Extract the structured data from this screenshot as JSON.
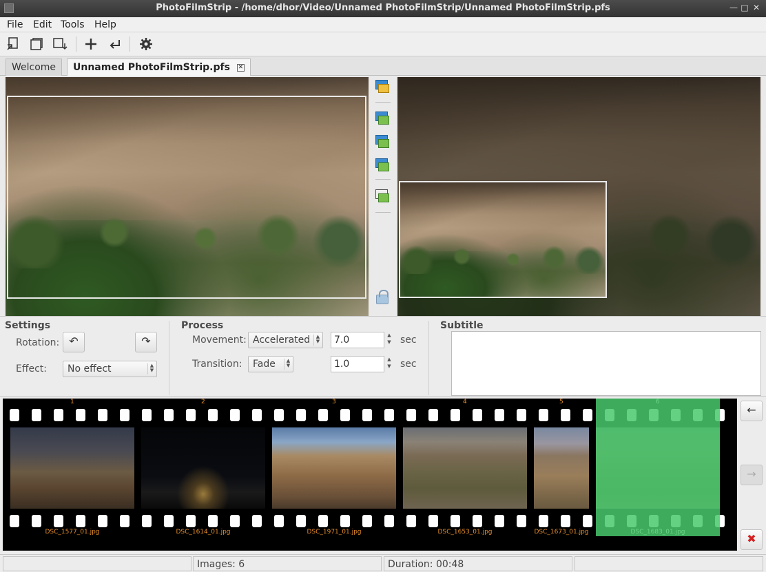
{
  "window": {
    "title": "PhotoFilmStrip - /home/dhor/Video/Unnamed PhotoFilmStrip/Unnamed PhotoFilmStrip.pfs",
    "controls": {
      "minimize": "—",
      "maximize": "□",
      "close": "✕"
    }
  },
  "menubar": {
    "items": [
      "File",
      "Edit",
      "Tools",
      "Help"
    ]
  },
  "toolbar": {
    "icons": [
      "new-project-icon",
      "open-project-icon",
      "save-project-icon",
      "add-images-icon",
      "undo-icon",
      "settings-icon"
    ]
  },
  "tabs": [
    {
      "label": "Welcome",
      "active": false
    },
    {
      "label": "Unnamed PhotoFilmStrip.pfs",
      "active": true,
      "close": "✕"
    }
  ],
  "settings": {
    "title": "Settings",
    "rotation_label": "Rotation:",
    "rotate_left": "↶",
    "rotate_right": "↷",
    "effect_label": "Effect:",
    "effect_value": "No effect"
  },
  "process": {
    "title": "Process",
    "movement_label": "Movement:",
    "movement_value": "Accelerated",
    "movement_duration": "7.0",
    "movement_unit": "sec",
    "transition_label": "Transition:",
    "transition_value": "Fade",
    "transition_duration": "1.0",
    "transition_unit": "sec"
  },
  "subtitle": {
    "title": "Subtitle",
    "value": ""
  },
  "filmstrip": {
    "items": [
      {
        "number": "1",
        "filename": "DSC_1577_01.jpg"
      },
      {
        "number": "2",
        "filename": "DSC_1614_01.jpg"
      },
      {
        "number": "3",
        "filename": "DSC_1971_01.jpg"
      },
      {
        "number": "4",
        "filename": "DSC_1653_01.jpg"
      },
      {
        "number": "5",
        "filename": "DSC_1673_01.jpg"
      },
      {
        "number": "6",
        "filename": "DSC_1683_01.jpg"
      }
    ],
    "selected_index": 5,
    "left_arrow": "←",
    "right_arrow": "→",
    "remove": "✖"
  },
  "statusbar": {
    "images": "Images: 6",
    "duration": "Duration: 00:48"
  },
  "colors": {
    "filename_orange": "#e88e2a",
    "selection_green": "#48c86c",
    "remove_red": "#d42020"
  }
}
